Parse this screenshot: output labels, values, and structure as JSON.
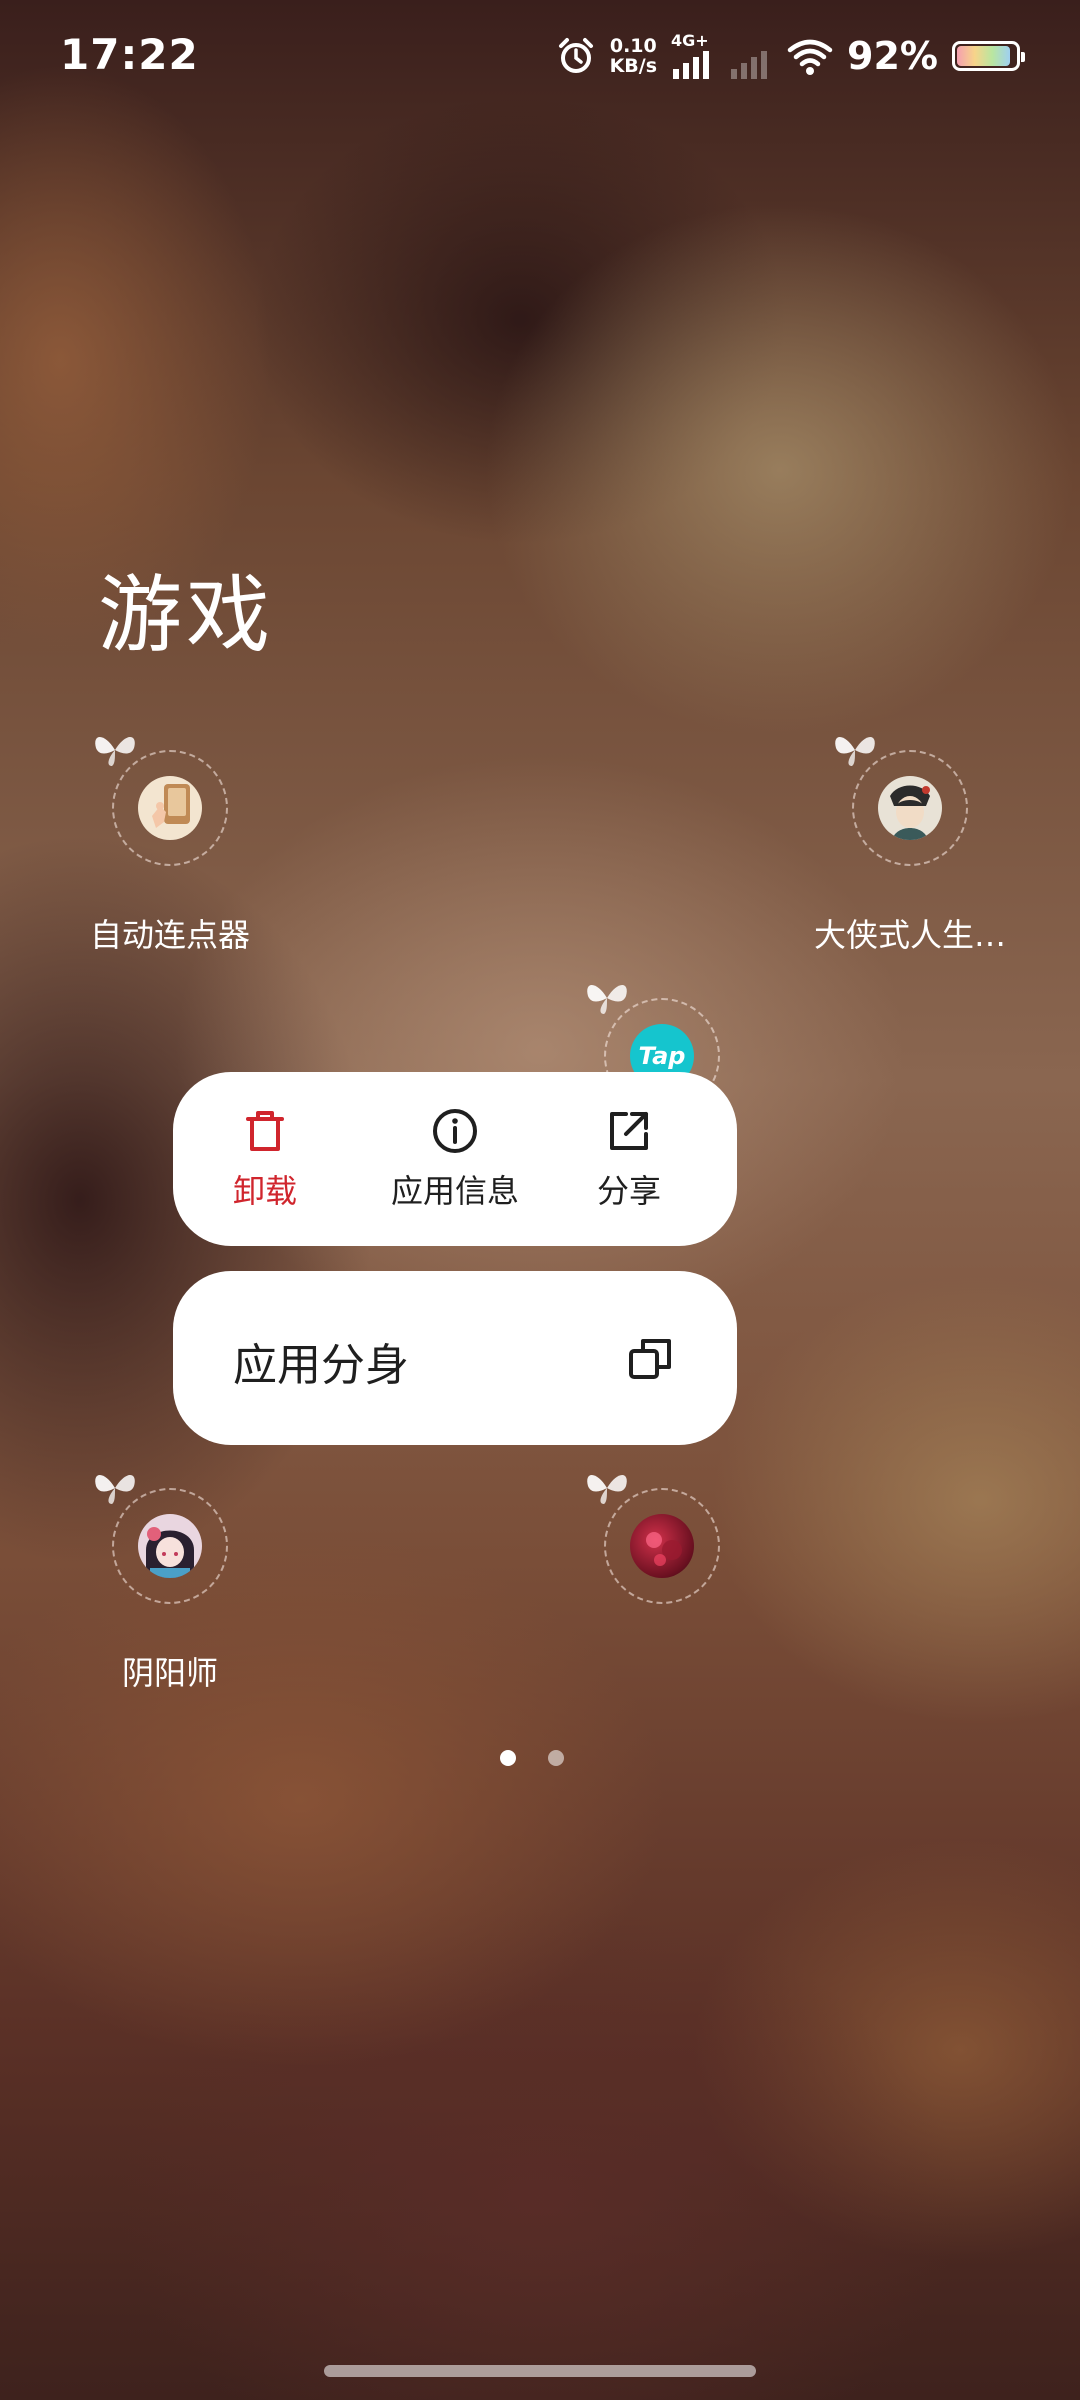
{
  "status_bar": {
    "time": "17:22",
    "net_speed_value": "0.10",
    "net_speed_unit": "KB/s",
    "network_type": "4G+",
    "battery_percent": "92%",
    "battery_level": 0.92
  },
  "folder": {
    "title": "游戏"
  },
  "apps": [
    {
      "label": "自动连点器",
      "icon": "auto-clicker-icon"
    },
    {
      "label": "大侠式人生…",
      "icon": "hero-life-game-icon"
    },
    {
      "label": "",
      "icon": "tap-icon",
      "icon_text": "Tap"
    },
    {
      "label": "阴阳师",
      "icon": "onmyoji-icon"
    },
    {
      "label": "",
      "icon": "red-game-icon"
    }
  ],
  "context_menu": {
    "actions": [
      {
        "label": "卸载",
        "icon": "trash-icon",
        "color": "#d0252d"
      },
      {
        "label": "应用信息",
        "icon": "info-icon"
      },
      {
        "label": "分享",
        "icon": "share-icon"
      }
    ],
    "clone": {
      "label": "应用分身",
      "icon": "clone-icon"
    }
  },
  "page_indicator": {
    "count": 2,
    "active_index": 0
  }
}
